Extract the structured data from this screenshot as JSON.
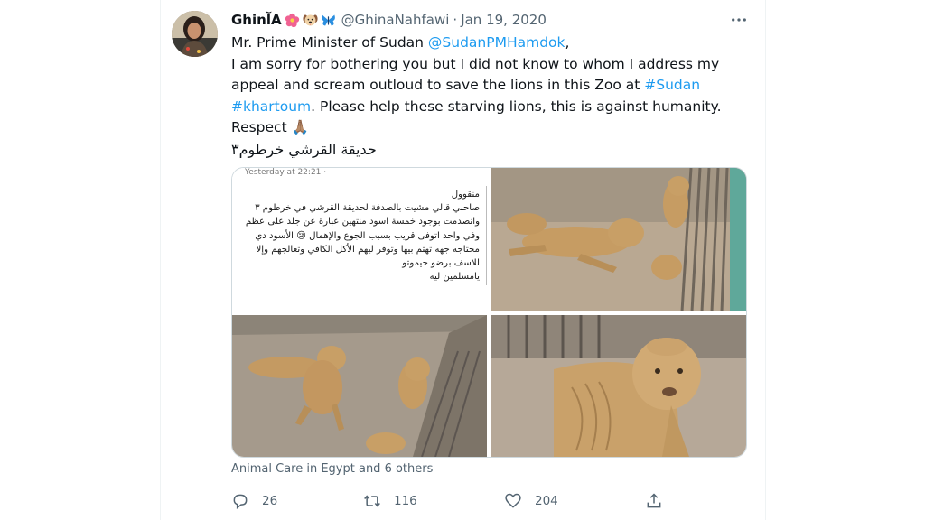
{
  "tweet": {
    "author_name": "GhinآA",
    "emojis": [
      "hibiscus-icon",
      "dog-face-icon",
      "butterfly-icon"
    ],
    "handle": "@GhinaNahfawi",
    "separator": "·",
    "date": "Jan 19, 2020",
    "more_icon": "more-options-icon",
    "text": {
      "line1_prefix": "Mr. Prime Minister of Sudan ",
      "line1_mention": "@SudanPMHamdok",
      "line1_suffix": ",",
      "line2": "I am sorry for bothering you but I did not know to whom I address my",
      "line3_prefix": "appeal and scream outloud to save the lions in this Zoo at ",
      "line3_hashtag": "#Sudan",
      "line4_hashtag": "#khartoum",
      "line4_suffix": ". Please help these starving lions, this is against humanity.",
      "line5": "Respect 🙏🏽",
      "line6_arabic": "حديقة القرشي خرطوم٣"
    },
    "media": {
      "post_timestamp": "Yesterday at 22:21 · ",
      "post_lines": [
        "منقوول",
        "صاحبي قالي مشيت بالصدفة لحديقة القرشي في خرطوم ٣",
        "وانصدمت بوجود خمسة اسود منتهين عبارة عن جلد على عظم",
        "وفي واحد اتوفى قريب بسبب الجوع والإهمال 😢 الأسود دي",
        "محتاجه جهه تهتم بيها وتوفر ليهم الأكل الكافي وتعالجهم وإلا",
        "للاسف برضو حيموتو",
        "يامسلمين ليه"
      ]
    },
    "caption": "Animal Care in Egypt and 6 others",
    "actions": {
      "reply_count": "26",
      "retweet_count": "116",
      "like_count": "204"
    },
    "colors": {
      "accent": "#1d9bf0",
      "secondary_text": "#536471",
      "primary_text": "#0f1419"
    }
  }
}
